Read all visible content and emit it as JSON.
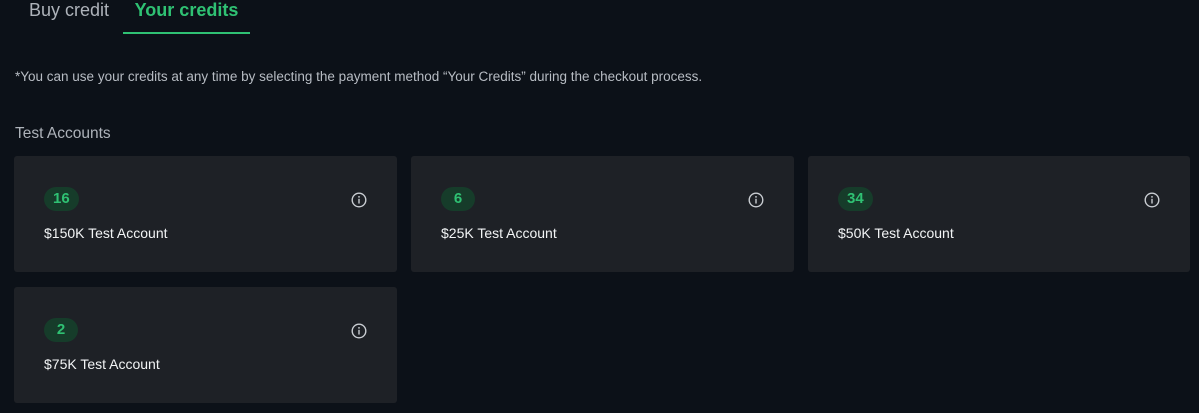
{
  "tabs": [
    {
      "label": "Buy credit",
      "active": false
    },
    {
      "label": "Your credits",
      "active": true
    }
  ],
  "note": "*You can use your credits at any time by selecting the payment method “Your Credits” during the checkout process.",
  "section_title": "Test Accounts",
  "cards": [
    {
      "count": "16",
      "label": "$150K Test Account",
      "icon": "info-icon"
    },
    {
      "count": "6",
      "label": "$25K Test Account",
      "icon": "info-icon"
    },
    {
      "count": "34",
      "label": "$50K Test Account",
      "icon": "info-icon"
    },
    {
      "count": "2",
      "label": "$75K Test Account",
      "icon": "info-icon"
    }
  ],
  "colors": {
    "background": "#0c1118",
    "card": "#1e2126",
    "accent": "#2fc173",
    "badge_bg": "#163c2a",
    "muted_text": "#aeb3ba"
  }
}
